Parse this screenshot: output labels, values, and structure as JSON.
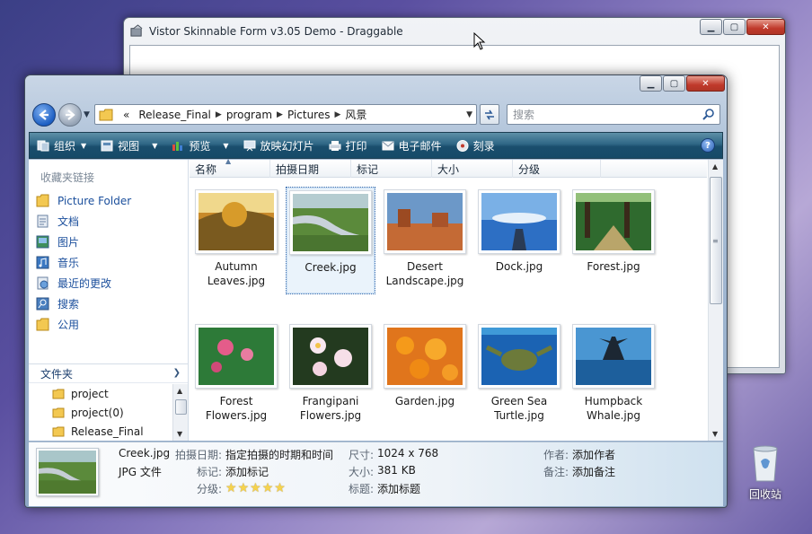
{
  "background_window": {
    "title": "Vistor Skinnable Form v3.05 Demo - Draggable"
  },
  "nav": {
    "breadcrumbs": [
      "Release_Final",
      "program",
      "Pictures",
      "风景"
    ],
    "breadcrumb_prefix": "«",
    "search_placeholder": "搜索"
  },
  "toolbar": {
    "items": [
      "组织",
      "视图",
      "预览",
      "放映幻灯片",
      "打印",
      "电子邮件",
      "刻录"
    ],
    "help": "?"
  },
  "sidebar": {
    "favorites_title": "收藏夹链接",
    "favorites": [
      "Picture Folder",
      "文档",
      "图片",
      "音乐",
      "最近的更改",
      "搜索",
      "公用"
    ],
    "folders_title": "文件夹",
    "tree": [
      "project",
      "project(0)",
      "Release_Final"
    ]
  },
  "columns": [
    "名称",
    "拍摄日期",
    "标记",
    "大小",
    "分级"
  ],
  "files": [
    {
      "line1": "Autumn",
      "line2": "Leaves.jpg",
      "thumb": "autumn"
    },
    {
      "line1": "Creek.jpg",
      "line2": "",
      "thumb": "creek",
      "selected": true
    },
    {
      "line1": "Desert",
      "line2": "Landscape.jpg",
      "thumb": "desert"
    },
    {
      "line1": "Dock.jpg",
      "line2": "",
      "thumb": "dock"
    },
    {
      "line1": "Forest.jpg",
      "line2": "",
      "thumb": "forest"
    },
    {
      "line1": "Forest",
      "line2": "Flowers.jpg",
      "thumb": "forestflowers"
    },
    {
      "line1": "Frangipani",
      "line2": "Flowers.jpg",
      "thumb": "frangipani"
    },
    {
      "line1": "Garden.jpg",
      "line2": "",
      "thumb": "garden"
    },
    {
      "line1": "Green Sea",
      "line2": "Turtle.jpg",
      "thumb": "turtle"
    },
    {
      "line1": "Humpback",
      "line2": "Whale.jpg",
      "thumb": "whale"
    }
  ],
  "details": {
    "name": "Creek.jpg",
    "type": "JPG 文件",
    "date_label": "拍摄日期:",
    "date_value": "指定拍摄的时期和时间",
    "tag_label": "标记:",
    "tag_value": "添加标记",
    "rating_label": "分级:",
    "rating": 0,
    "dims_label": "尺寸:",
    "dims_value": "1024 x 768",
    "size_label": "大小:",
    "size_value": "381 KB",
    "title_label": "标题:",
    "title_value": "添加标题",
    "author_label": "作者:",
    "author_value": "添加作者",
    "comment_label": "备注:",
    "comment_value": "添加备注"
  },
  "desktop": {
    "recycle_label": "回收站"
  }
}
